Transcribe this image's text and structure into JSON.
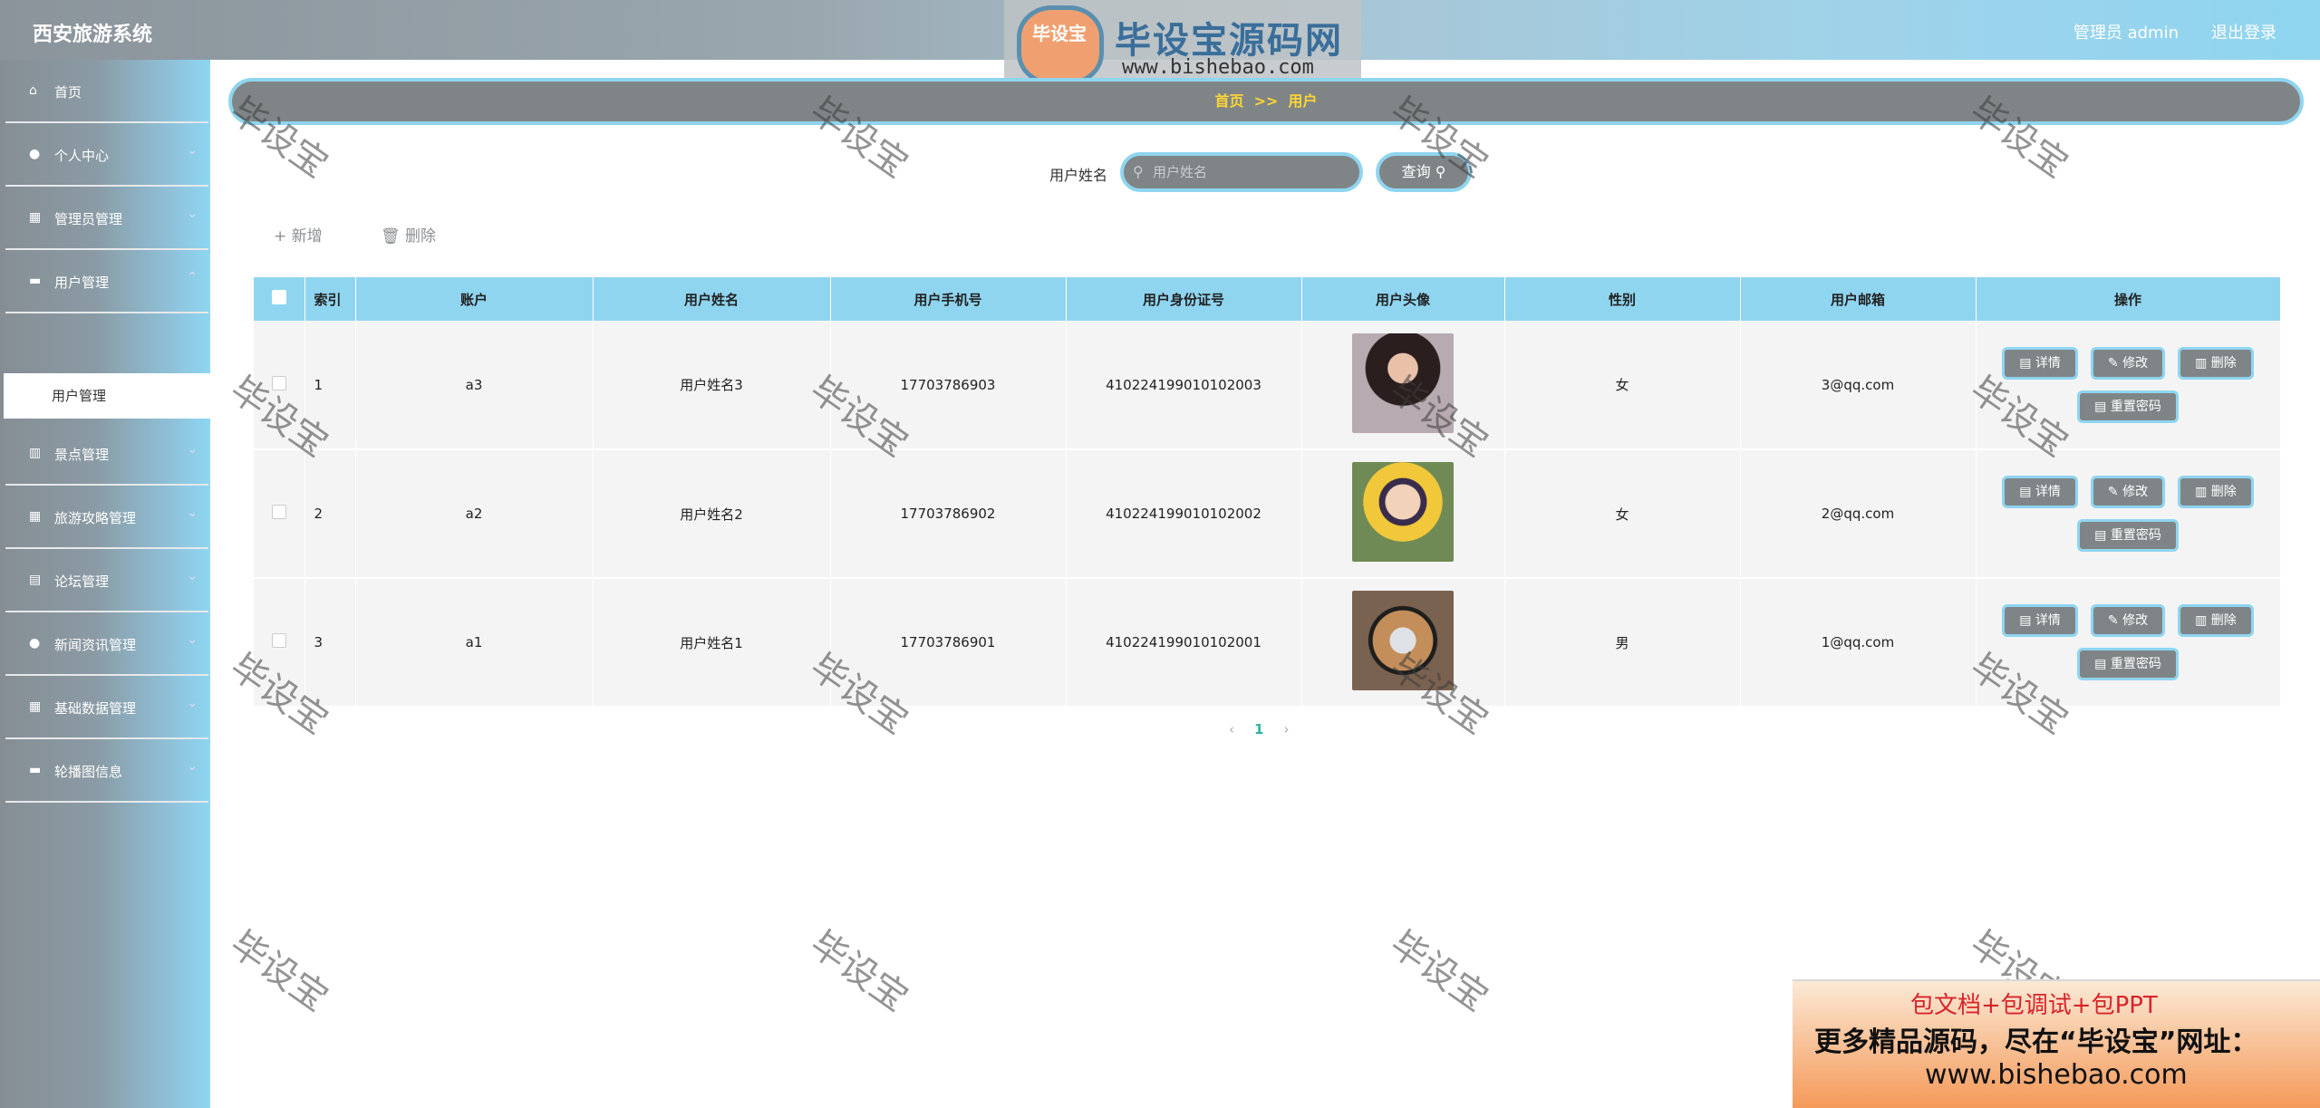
{
  "header": {
    "app_title": "西安旅游系统",
    "user_label": "管理员 admin",
    "logout_label": "退出登录"
  },
  "logo": {
    "badge_text": "毕设宝",
    "text": "毕设宝源码网",
    "url": "www.bishebao.com"
  },
  "sidebar": {
    "items": [
      {
        "label": "首页",
        "icon": "home-icon",
        "glyph": "⌂",
        "has_children": false
      },
      {
        "label": "个人中心",
        "icon": "user-icon",
        "glyph": "👤",
        "has_children": true
      },
      {
        "label": "管理员管理",
        "icon": "grid-icon",
        "glyph": "▦",
        "has_children": true
      },
      {
        "label": "用户管理",
        "icon": "message-icon",
        "glyph": "▬",
        "has_children": true
      },
      {
        "label": "景点管理",
        "icon": "chart-icon",
        "glyph": "▥",
        "has_children": true
      },
      {
        "label": "旅游攻略管理",
        "icon": "grid-icon",
        "glyph": "▦",
        "has_children": true
      },
      {
        "label": "论坛管理",
        "icon": "doc-icon",
        "glyph": "▤",
        "has_children": true
      },
      {
        "label": "新闻资讯管理",
        "icon": "location-icon",
        "glyph": "●",
        "has_children": true
      },
      {
        "label": "基础数据管理",
        "icon": "grid-icon",
        "glyph": "▦",
        "has_children": true
      },
      {
        "label": "轮播图信息",
        "icon": "carousel-icon",
        "glyph": "▬",
        "has_children": true
      }
    ],
    "active_sub": "用户管理"
  },
  "breadcrumb": {
    "home": "首页",
    "sep": ">>",
    "current": "用户"
  },
  "search": {
    "label": "用户姓名",
    "placeholder": "用户姓名",
    "button": "查询"
  },
  "actions": {
    "add": "新增",
    "delete": "删除"
  },
  "table": {
    "columns": [
      "",
      "索引",
      "账户",
      "用户姓名",
      "用户手机号",
      "用户身份证号",
      "用户头像",
      "性别",
      "用户邮箱",
      "操作"
    ],
    "rows": [
      {
        "index": "1",
        "account": "a3",
        "name": "用户姓名3",
        "phone": "17703786903",
        "id_card": "410224199010102003",
        "gender": "女",
        "email": "3@qq.com"
      },
      {
        "index": "2",
        "account": "a2",
        "name": "用户姓名2",
        "phone": "17703786902",
        "id_card": "410224199010102002",
        "gender": "女",
        "email": "2@qq.com"
      },
      {
        "index": "3",
        "account": "a1",
        "name": "用户姓名1",
        "phone": "17703786901",
        "id_card": "410224199010102001",
        "gender": "男",
        "email": "1@qq.com"
      }
    ],
    "op_labels": {
      "detail": "详情",
      "edit": "修改",
      "delete": "删除",
      "reset": "重置密码"
    }
  },
  "pager": {
    "prev": "‹",
    "current": "1",
    "next": "›"
  },
  "watermark": "毕设宝",
  "banner": {
    "line1": "包文档+包调试+包PPT",
    "line2": "更多精品源码，尽在“毕设宝”网址：",
    "line3": "www.bishebao.com"
  },
  "colors": {
    "accent": "#8fd5f0",
    "button_bg": "#7f8587",
    "breadcrumb_text": "#ffd633",
    "pager_current": "#2bb3a3"
  }
}
